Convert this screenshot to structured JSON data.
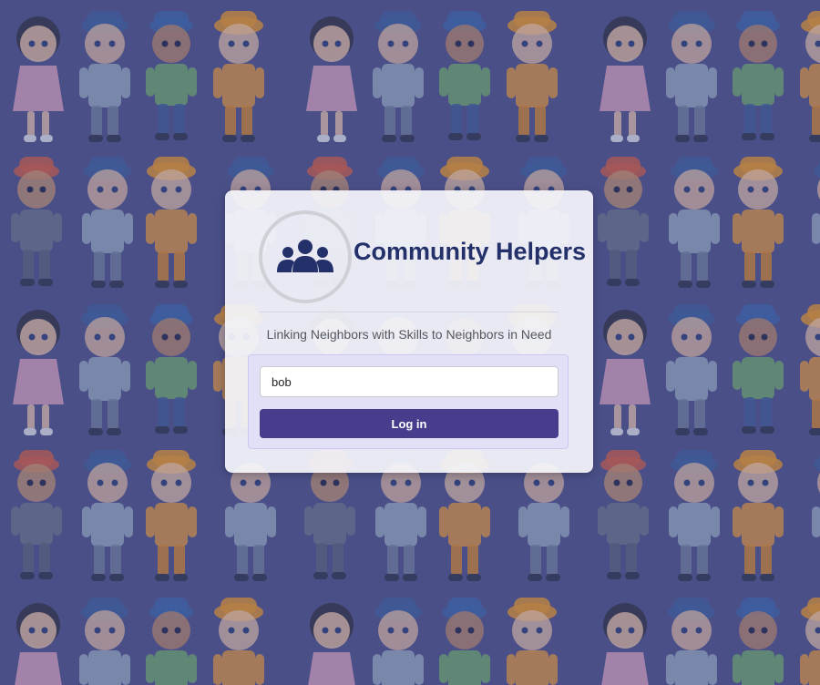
{
  "app": {
    "title": "Community Helpers",
    "tagline": "Linking Neighbors with Skills to Neighbors in Need",
    "logo_icon": "users-group-icon"
  },
  "login": {
    "username_value": "bob",
    "button_label": "Log in"
  },
  "background": {
    "pattern": "cartoon community helper characters",
    "color": "#4a5088"
  },
  "colors": {
    "title": "#23306a",
    "button": "#463d8d",
    "login_panel": "#e1e0f6"
  }
}
